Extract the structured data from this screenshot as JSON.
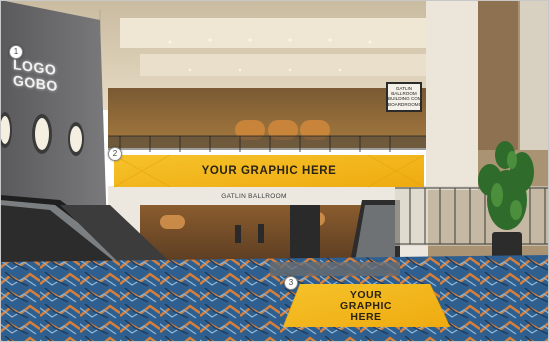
{
  "scene": {
    "logo_gobo_text": "LOGO GOBO",
    "banner_text": "YOUR GRAPHIC HERE",
    "floor_graphic_text": "YOUR\nGRAPHIC\nHERE",
    "ballroom_strip_text": "GATLIN BALLROOM",
    "directional_sign_lines": [
      "GATLIN",
      "BALLROOM",
      "BUILDING COMMUNITY",
      "BOARDROOMS"
    ],
    "markers": [
      "1",
      "2",
      "3"
    ]
  },
  "colors": {
    "graphic_yellow": "#f3b617",
    "carpet_blue": "#2f5f8f",
    "wall_gray": "#6e6e70",
    "ceiling_beige": "#d8cbb1"
  }
}
